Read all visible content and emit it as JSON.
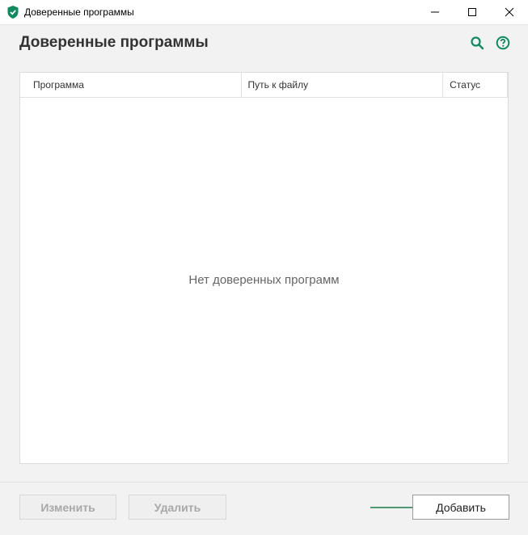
{
  "window": {
    "title": "Доверенные программы",
    "controls": {
      "minimize": "—",
      "maximize": "☐",
      "close": "✕"
    }
  },
  "header": {
    "page_title": "Доверенные программы",
    "icons": [
      "search-icon",
      "help-icon"
    ]
  },
  "table": {
    "columns": [
      "Программа",
      "Путь к файлу",
      "Статус"
    ],
    "rows": [],
    "empty_message": "Нет доверенных программ"
  },
  "footer": {
    "edit_label": "Изменить",
    "delete_label": "Удалить",
    "add_label": "Добавить"
  },
  "colors": {
    "accent": "#0f8a5f",
    "annotation_arrow": "#1a7a4a"
  }
}
